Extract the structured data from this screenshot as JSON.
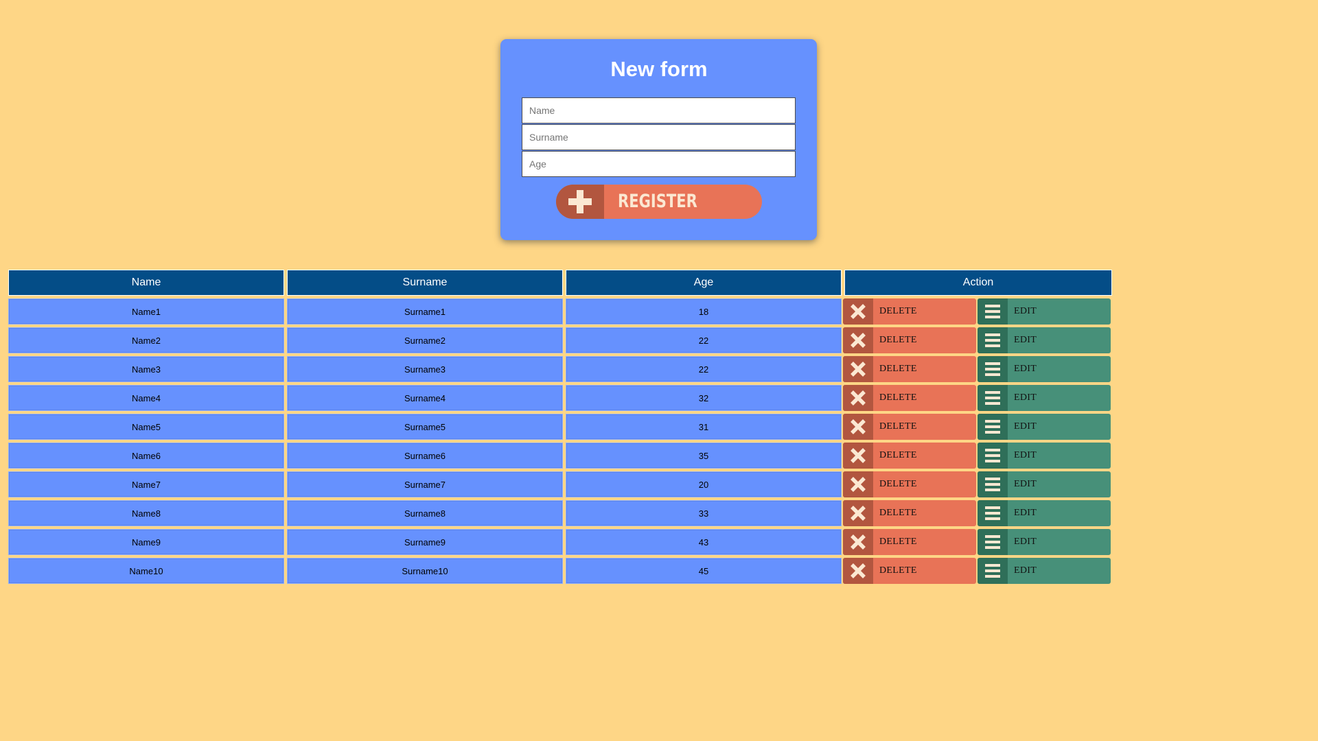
{
  "form": {
    "title": "New form",
    "name_placeholder": "Name",
    "surname_placeholder": "Surname",
    "age_placeholder": "Age",
    "register_label": "REGISTER"
  },
  "table": {
    "headers": [
      "Name",
      "Surname",
      "Age",
      "Action"
    ],
    "delete_label": "DELETE",
    "edit_label": "EDIT",
    "rows": [
      {
        "name": "Name1",
        "surname": "Surname1",
        "age": "18"
      },
      {
        "name": "Name2",
        "surname": "Surname2",
        "age": "22"
      },
      {
        "name": "Name3",
        "surname": "Surname3",
        "age": "22"
      },
      {
        "name": "Name4",
        "surname": "Surname4",
        "age": "32"
      },
      {
        "name": "Name5",
        "surname": "Surname5",
        "age": "31"
      },
      {
        "name": "Name6",
        "surname": "Surname6",
        "age": "35"
      },
      {
        "name": "Name7",
        "surname": "Surname7",
        "age": "20"
      },
      {
        "name": "Name8",
        "surname": "Surname8",
        "age": "33"
      },
      {
        "name": "Name9",
        "surname": "Surname9",
        "age": "43"
      },
      {
        "name": "Name10",
        "surname": "Surname10",
        "age": "45"
      }
    ]
  },
  "icons": {
    "register": "plus-icon",
    "delete": "close-icon",
    "edit": "menu-icon"
  },
  "colors": {
    "background": "#FED686",
    "card": "#6691FE",
    "header": "#044D87",
    "delete": "#E87357",
    "delete_dark": "#B2563F",
    "edit": "#479079",
    "edit_dark": "#2F6F59",
    "icon_cream": "#FBE8D2"
  }
}
